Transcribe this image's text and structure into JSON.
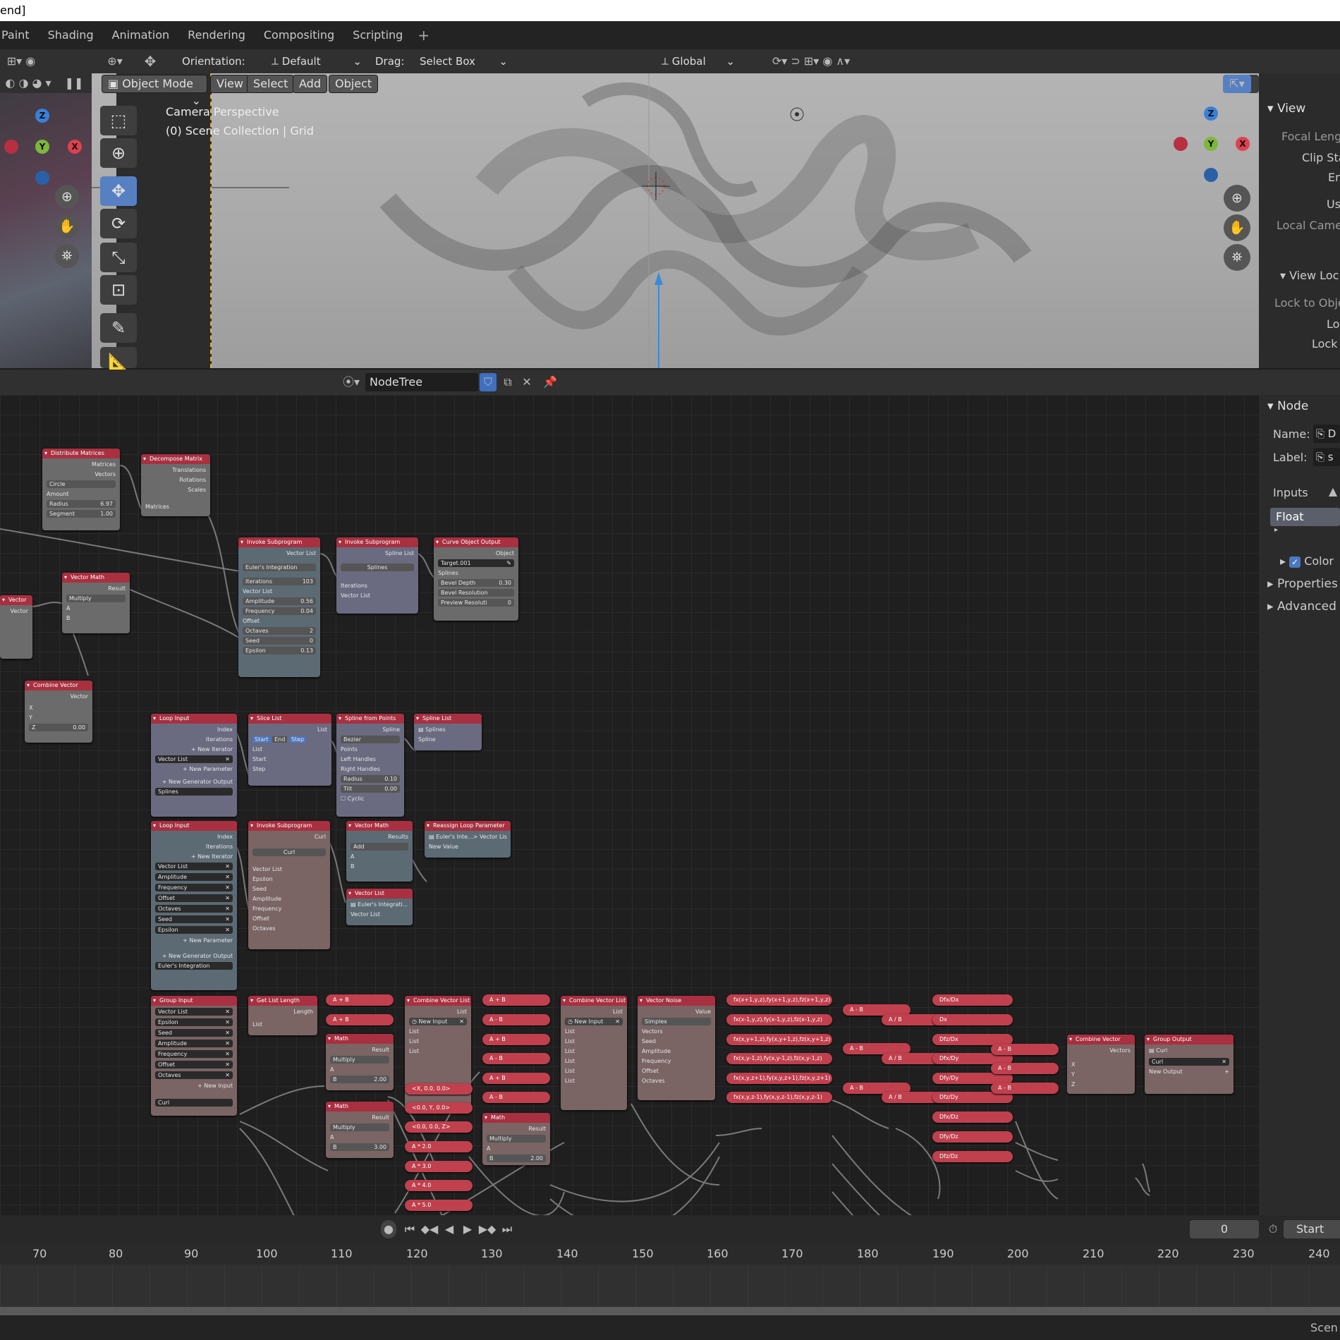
{
  "window": {
    "title_fragment": "end]"
  },
  "workspaces": [
    "Paint",
    "Shading",
    "Animation",
    "Rendering",
    "Compositing",
    "Scripting"
  ],
  "header": {
    "orientation_label": "Orientation:",
    "orientation_value": "Default",
    "drag_label": "Drag:",
    "drag_value": "Select Box",
    "transform_space": "Global"
  },
  "viewport_header": {
    "mode": "Object Mode",
    "menus": [
      "View",
      "Select",
      "Add",
      "Object"
    ]
  },
  "viewport": {
    "camera_text": "Camera Perspective",
    "collection_text": "(0) Scene Collection | Grid",
    "gizmo": {
      "x": "X",
      "y": "Y",
      "z": "Z"
    }
  },
  "view_panel": {
    "section_view": "View",
    "focal": "Focal Lengt",
    "clip": "Clip Sta",
    "end": "En",
    "use": "Us",
    "local_camera": "Local Camer",
    "section_lock": "View Loc",
    "lock_obj": "Lock to Objec",
    "lo": "Lo",
    "lock_c": "Lock C"
  },
  "node_editor_header": {
    "tree_name": "NodeTree"
  },
  "node_sidebar": {
    "section": "Node",
    "name_label": "Name:",
    "name_value": "D",
    "label_label": "Label:",
    "label_value": "s",
    "inputs": "Inputs",
    "float": "Float",
    "color": "Color",
    "properties": "Properties",
    "advanced": "Advanced I"
  },
  "nodes": {
    "distribute": {
      "title": "Distribute Matrices",
      "rows": [
        "Matrices",
        "Vectors"
      ],
      "mode": "Circle",
      "amount": "Amount",
      "radius_label": "Radius",
      "radius_value": "6.97",
      "segment_label": "Segment",
      "segment_value": "1.00"
    },
    "decompose": {
      "title": "Decompose Matrix",
      "rows": [
        "Translations",
        "Rotations",
        "Scales"
      ],
      "input": "Matrices"
    },
    "invoke1": {
      "title": "Invoke Subprogram",
      "out": "Vector List",
      "prog": "Euler's Integration",
      "iter_label": "Iterations",
      "iter_value": "103",
      "vlist": "Vector List",
      "amp_label": "Amplitude",
      "amp_value": "0.56",
      "freq_label": "Frequency",
      "freq_value": "0.04",
      "offset": "Offset",
      "oct_label": "Octaves",
      "oct_value": "2",
      "seed_label": "Seed",
      "seed_value": "0",
      "eps_label": "Epsilon",
      "eps_value": "0.13"
    },
    "invoke2": {
      "title": "Invoke Subprogram",
      "out": "Spline List",
      "prog": "Splines",
      "iter": "Iterations",
      "vlist": "Vector List"
    },
    "curve": {
      "title": "Curve Object Output",
      "out": "Object",
      "target": "Target.001",
      "splines": "Splines",
      "bevel_label": "Bevel Depth",
      "bevel_value": "0.30",
      "bevel_res": "Bevel Resolution",
      "prev_label": "Preview Resoluti",
      "prev_value": "0"
    },
    "vecmath1": {
      "title": "Vector Math",
      "out": "Result",
      "op": "Multiply",
      "a": "A",
      "b": "B"
    },
    "vector": {
      "title": "Vector",
      "out": "Vector"
    },
    "combine1": {
      "title": "Combine Vector",
      "out": "Vector",
      "x": "X",
      "y": "Y",
      "z_label": "Z",
      "z_value": "0.00"
    },
    "loop1": {
      "title": "Loop Input",
      "rows": [
        "Index",
        "Iterations"
      ],
      "new_iter": "New Iterator",
      "vlist": "Vector List",
      "new_param": "New Parameter",
      "new_gen": "New Generator Output",
      "splines": "Splines"
    },
    "slice": {
      "title": "Slice List",
      "out": "List",
      "start": "Start",
      "end": "End",
      "step": "Step",
      "rows": [
        "List",
        "Start",
        "Step"
      ]
    },
    "spline_pts": {
      "title": "Spline from Points",
      "out": "Spline",
      "type": "Bezier",
      "rows": [
        "Points",
        "Left Handles",
        "Right Handles"
      ],
      "radius_label": "Radius",
      "radius_value": "0.10",
      "tilt_label": "Tilt",
      "tilt_value": "0.00",
      "cyclic": "Cyclic"
    },
    "spline_list": {
      "title": "Spline List",
      "splines": "Splines",
      "spline": "Spline"
    },
    "loop2": {
      "title": "Loop Input",
      "rows": [
        "Index",
        "Iterations"
      ],
      "new_iter": "New Iterator",
      "params": [
        "Vector List",
        "Amplitude",
        "Frequency",
        "Offset",
        "Octaves",
        "Seed",
        "Epsilon"
      ],
      "new_param": "New Parameter",
      "new_gen": "New Generator Output",
      "euler": "Euler's Integration"
    },
    "invoke3": {
      "title": "Invoke Subprogram",
      "out": "Curl",
      "prog": "Curl",
      "rows": [
        "Vector List",
        "Epsilon",
        "Seed",
        "Amplitude",
        "Frequency",
        "Offset",
        "Octaves"
      ]
    },
    "vecmath2": {
      "title": "Vector Math",
      "out": "Results",
      "op": "Add",
      "a": "A",
      "b": "B"
    },
    "reassign": {
      "title": "Reassign Loop Parameter",
      "param": "Euler's Inte...> Vector Lis",
      "new_value": "New Value"
    },
    "vlist": {
      "title": "Vector List",
      "item": "Euler's Integrati...",
      "out": "Vector List"
    },
    "group_in": {
      "title": "Group Input",
      "params": [
        "Vector List",
        "Epsilon",
        "Seed",
        "Amplitude",
        "Frequency",
        "Offset",
        "Octaves"
      ],
      "new_input": "New Input",
      "curl": "Curl"
    },
    "get_len": {
      "title": "Get List Length",
      "out": "Length",
      "in": "List"
    },
    "math1": {
      "title": "Math",
      "out": "Result",
      "op": "Multiply",
      "a": "A",
      "b_label": "B",
      "b_value": "2.00"
    },
    "math2": {
      "title": "Math",
      "out": "Result",
      "op": "Multiply",
      "a": "A",
      "b_label": "B",
      "b_value": "3.00"
    },
    "math3": {
      "title": "Math",
      "out": "Result",
      "op": "Multiply",
      "a": "A",
      "b_label": "B",
      "b_value": "2.00"
    },
    "cvl1": {
      "title": "Combine Vector List",
      "out": "List",
      "new_input": "New Input",
      "rows": [
        "List",
        "List",
        "List"
      ]
    },
    "cvl2": {
      "title": "Combine Vector List",
      "out": "List",
      "new_input": "New Input",
      "rows": [
        "List",
        "List",
        "List",
        "List",
        "List",
        "List"
      ]
    },
    "vnoise": {
      "title": "Vector Noise",
      "out": "Value",
      "type": "Simplex",
      "rows": [
        "Vectors",
        "Seed",
        "Amplitude",
        "Frequency",
        "Offset",
        "Octaves"
      ]
    },
    "combine2": {
      "title": "Combine Vector",
      "out": "Vectors",
      "x": "X",
      "y": "Y",
      "z": "Z"
    },
    "group_out": {
      "title": "Group Output",
      "curl": "Curl",
      "curl_field": "Curl",
      "new_output": "New Output"
    },
    "pills_a": [
      "A + B",
      "A + B"
    ],
    "pills_b": [
      "<X, 0.0, 0.0>",
      "<0.0, Y, 0.0>",
      "<0.0, 0.0, Z>",
      "A * 2.0",
      "A * 3.0",
      "A * 4.0",
      "A * 5.0"
    ],
    "pills_c": [
      "A + B",
      "A - B",
      "A + B",
      "A - B",
      "A + B",
      "A - B"
    ],
    "pills_expr": [
      "fx(x+1,y,z),fy(x+1,y,z),fz(x+1,y,z)",
      "fx(x-1,y,z),fy(x-1,y,z),fz(x-1,y,z)",
      "fx(x,y+1,z),fy(x,y+1,z),fz(x,y+1,z)",
      "fx(x,y-1,z),fy(x,y-1,z),fz(x,y-1,z)",
      "fx(x,y,z+1),fy(x,y,z+1),fz(x,y,z+1)",
      "fx(x,y,z-1),fy(x,y,z-1),fz(x,y,z-1)"
    ],
    "pills_sub": [
      "A - B",
      "A - B",
      "A - B"
    ],
    "pills_div": [
      "A / B",
      "A / B",
      "A / B"
    ],
    "pills_deriv": [
      "Dfx/Dx",
      "Dx",
      "Dfz/Dx",
      "Dfx/Dy",
      "Dfy/Dy",
      "Dfz/Dy",
      "Dfx/Dz",
      "Dfy/Dz",
      "Dfz/Dz"
    ],
    "pills_final": [
      "A - B",
      "A - B",
      "A - B"
    ]
  },
  "timeline": {
    "current_frame": "0",
    "start_label": "Start",
    "ticks": [
      "70",
      "80",
      "90",
      "100",
      "110",
      "120",
      "130",
      "140",
      "150",
      "160",
      "170",
      "180",
      "190",
      "200",
      "210",
      "220",
      "230",
      "240"
    ]
  },
  "status": {
    "right": "Scen"
  }
}
